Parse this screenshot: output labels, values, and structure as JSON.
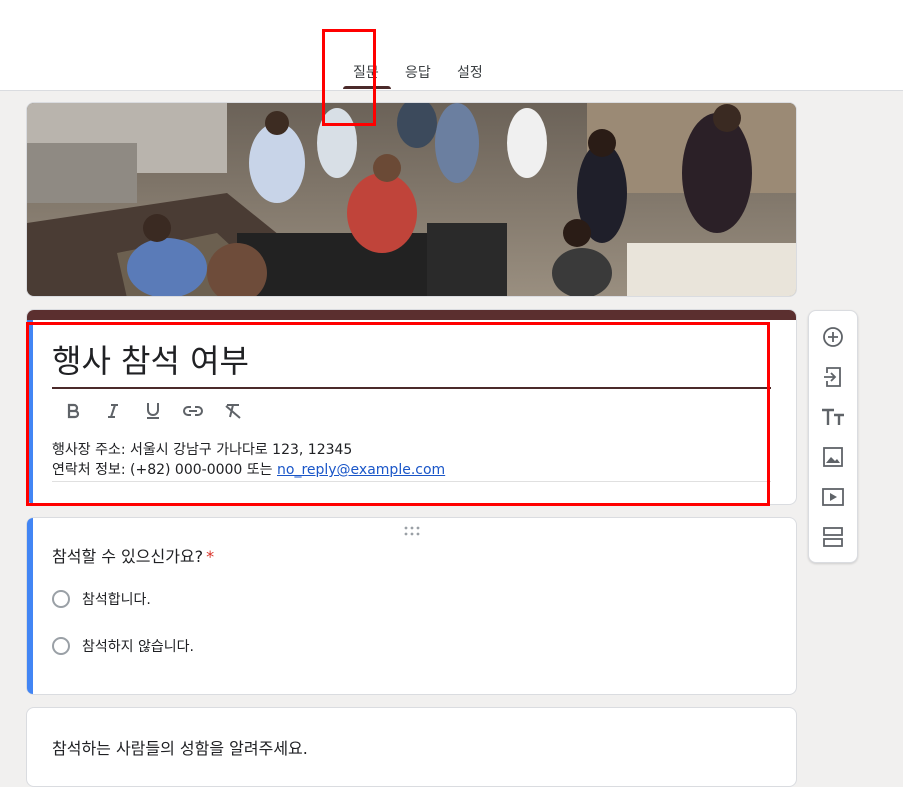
{
  "tabs": [
    {
      "label": "질문",
      "active": true
    },
    {
      "label": "응답",
      "active": false
    },
    {
      "label": "설정",
      "active": false
    }
  ],
  "form": {
    "title": "행사 참석 여부",
    "description_line1": "행사장 주소: 서울시 강남구 가나다로 123, 12345",
    "description_line2_prefix": "연락처 정보: (+82) 000-0000 또는 ",
    "description_email": "no_reply@example.com"
  },
  "format_toolbar": [
    "bold-icon",
    "italic-icon",
    "underline-icon",
    "link-icon",
    "clear-format-icon"
  ],
  "sidebar_tools": [
    "add-question-icon",
    "import-questions-icon",
    "add-title-icon",
    "add-image-icon",
    "add-video-icon",
    "add-section-icon"
  ],
  "questions": [
    {
      "title": "참석할 수 있으신가요?",
      "required_mark": "*",
      "options": [
        "참석합니다.",
        "참석하지 않습니다."
      ]
    },
    {
      "title": "참석하는 사람들의 성함을 알려주세요."
    }
  ],
  "colors": {
    "theme": "#5b2f2f",
    "accent_blue": "#4285f4",
    "highlight_red": "#ff0000",
    "page_bg": "#f1f0ef"
  }
}
